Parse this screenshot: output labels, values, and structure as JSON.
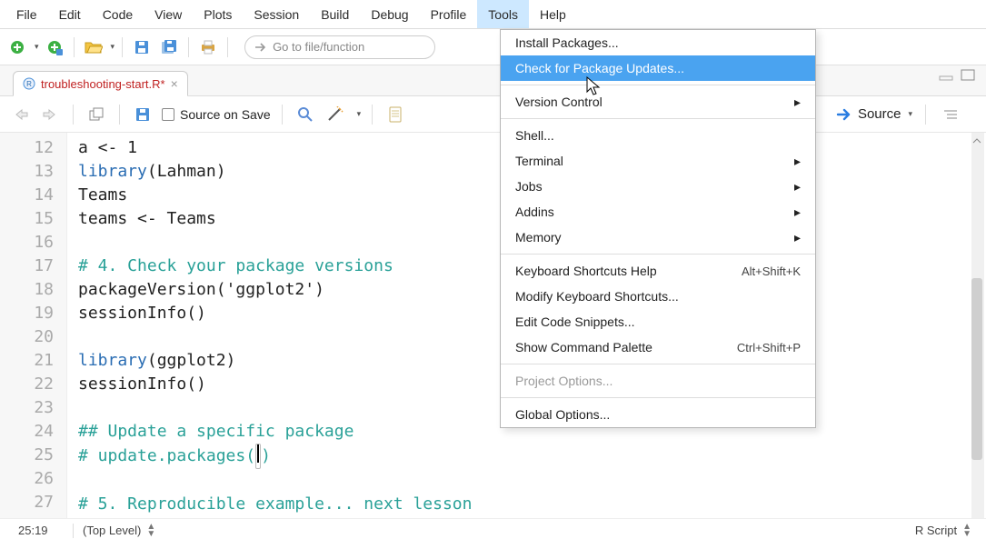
{
  "menubar": [
    "File",
    "Edit",
    "Code",
    "View",
    "Plots",
    "Session",
    "Build",
    "Debug",
    "Profile",
    "Tools",
    "Help"
  ],
  "menubar_active_index": 9,
  "goto_placeholder": "Go to file/function",
  "tab": {
    "name": "troubleshooting-start.R*",
    "dirty": true
  },
  "editor_toolbar": {
    "source_on_save_label": "Source on Save",
    "source_button_label": "Source"
  },
  "code": {
    "first_line_number": 12,
    "lines": [
      {
        "tokens": [
          {
            "t": "a <- 1"
          }
        ]
      },
      {
        "tokens": [
          {
            "t": "library",
            "c": "kw"
          },
          {
            "t": "(Lahman)"
          }
        ]
      },
      {
        "tokens": [
          {
            "t": "Teams"
          }
        ]
      },
      {
        "tokens": [
          {
            "t": "teams <- Teams"
          }
        ]
      },
      {
        "tokens": [
          {
            "t": ""
          }
        ]
      },
      {
        "tokens": [
          {
            "t": "# 4. Check your package versions",
            "c": "cmt"
          }
        ]
      },
      {
        "tokens": [
          {
            "t": "packageVersion('ggplot2')"
          }
        ]
      },
      {
        "tokens": [
          {
            "t": "sessionInfo()"
          }
        ]
      },
      {
        "tokens": [
          {
            "t": ""
          }
        ]
      },
      {
        "tokens": [
          {
            "t": "library",
            "c": "kw"
          },
          {
            "t": "(ggplot2)"
          }
        ]
      },
      {
        "tokens": [
          {
            "t": "sessionInfo()"
          }
        ]
      },
      {
        "tokens": [
          {
            "t": ""
          }
        ]
      },
      {
        "tokens": [
          {
            "t": "## Update a specific package",
            "c": "cmt"
          }
        ]
      },
      {
        "tokens": [
          {
            "t": "# update.packages(",
            "c": "cmt"
          },
          {
            "t": "CURSOR"
          },
          {
            "t": ")",
            "c": "cmt"
          }
        ]
      },
      {
        "tokens": [
          {
            "t": ""
          }
        ]
      },
      {
        "tokens": [
          {
            "t": "# 5. Reproducible example... next lesson",
            "c": "cmt"
          }
        ]
      }
    ]
  },
  "statusbar": {
    "position": "25:19",
    "scope": "(Top Level)",
    "language": "R Script"
  },
  "tools_menu": {
    "groups": [
      [
        {
          "label": "Install Packages..."
        },
        {
          "label": "Check for Package Updates...",
          "highlighted": true
        }
      ],
      [
        {
          "label": "Version Control",
          "submenu": true
        }
      ],
      [
        {
          "label": "Shell..."
        },
        {
          "label": "Terminal",
          "submenu": true
        },
        {
          "label": "Jobs",
          "submenu": true
        },
        {
          "label": "Addins",
          "submenu": true
        },
        {
          "label": "Memory",
          "submenu": true
        }
      ],
      [
        {
          "label": "Keyboard Shortcuts Help",
          "shortcut": "Alt+Shift+K"
        },
        {
          "label": "Modify Keyboard Shortcuts..."
        },
        {
          "label": "Edit Code Snippets..."
        },
        {
          "label": "Show Command Palette",
          "shortcut": "Ctrl+Shift+P"
        }
      ],
      [
        {
          "label": "Project Options...",
          "disabled": true
        }
      ],
      [
        {
          "label": "Global Options..."
        }
      ]
    ]
  }
}
